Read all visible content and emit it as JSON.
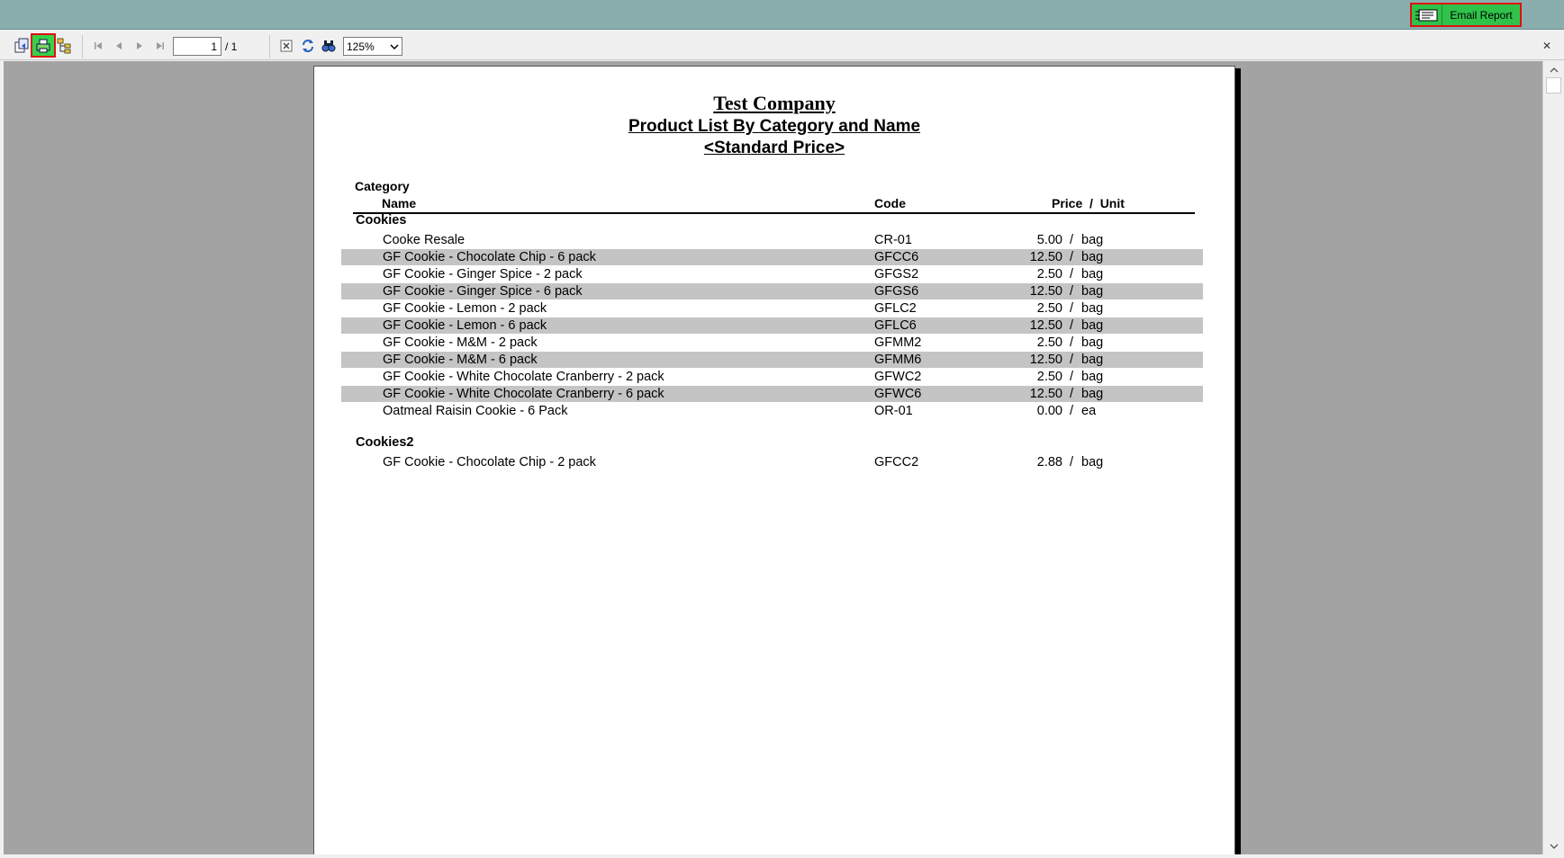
{
  "topbar": {
    "email_label": "Email Report"
  },
  "toolbar": {
    "current_page": "1",
    "page_total": "/ 1",
    "zoom": "125%",
    "close_glyph": "✕",
    "icons": [
      "export-icon",
      "print-icon",
      "group-tree-icon",
      "first-page-icon",
      "prev-page-icon",
      "next-page-icon",
      "last-page-icon",
      "close-view-icon",
      "refresh-icon",
      "find-icon"
    ]
  },
  "report": {
    "company": "Test Company",
    "title": "Product List By Category and Name",
    "subtitle": "<Standard Price>",
    "headers": {
      "category": "Category",
      "name": "Name",
      "code": "Code",
      "price_unit": "Price  /  Unit"
    },
    "groups": [
      {
        "category": "Cookies",
        "rows": [
          {
            "name": "Cooke Resale",
            "code": "CR-01",
            "price": "5.00",
            "unit": "bag"
          },
          {
            "name": "GF Cookie - Chocolate Chip - 6 pack",
            "code": "GFCC6",
            "price": "12.50",
            "unit": "bag"
          },
          {
            "name": "GF Cookie - Ginger Spice - 2 pack",
            "code": "GFGS2",
            "price": "2.50",
            "unit": "bag"
          },
          {
            "name": "GF Cookie - Ginger Spice - 6 pack",
            "code": "GFGS6",
            "price": "12.50",
            "unit": "bag"
          },
          {
            "name": "GF Cookie - Lemon - 2 pack",
            "code": "GFLC2",
            "price": "2.50",
            "unit": "bag"
          },
          {
            "name": "GF Cookie - Lemon - 6 pack",
            "code": "GFLC6",
            "price": "12.50",
            "unit": "bag"
          },
          {
            "name": "GF Cookie - M&M - 2 pack",
            "code": "GFMM2",
            "price": "2.50",
            "unit": "bag"
          },
          {
            "name": "GF Cookie - M&M - 6 pack",
            "code": "GFMM6",
            "price": "12.50",
            "unit": "bag"
          },
          {
            "name": "GF Cookie - White Chocolate Cranberry - 2 pack",
            "code": "GFWC2",
            "price": "2.50",
            "unit": "bag"
          },
          {
            "name": "GF Cookie - White Chocolate Cranberry - 6 pack",
            "code": "GFWC6",
            "price": "12.50",
            "unit": "bag"
          },
          {
            "name": "Oatmeal Raisin Cookie - 6 Pack",
            "code": "OR-01",
            "price": "0.00",
            "unit": "ea"
          }
        ]
      },
      {
        "category": "Cookies2",
        "rows": [
          {
            "name": "GF Cookie - Chocolate Chip - 2 pack",
            "code": "GFCC2",
            "price": "2.88",
            "unit": "bag"
          }
        ]
      }
    ]
  },
  "colors": {
    "topbar": "#8aaeae",
    "highlight_green": "#37d24a",
    "highlight_border": "#e01010",
    "viewer_bg": "#a3a3a3",
    "row_shade": "#c4c4c4"
  }
}
